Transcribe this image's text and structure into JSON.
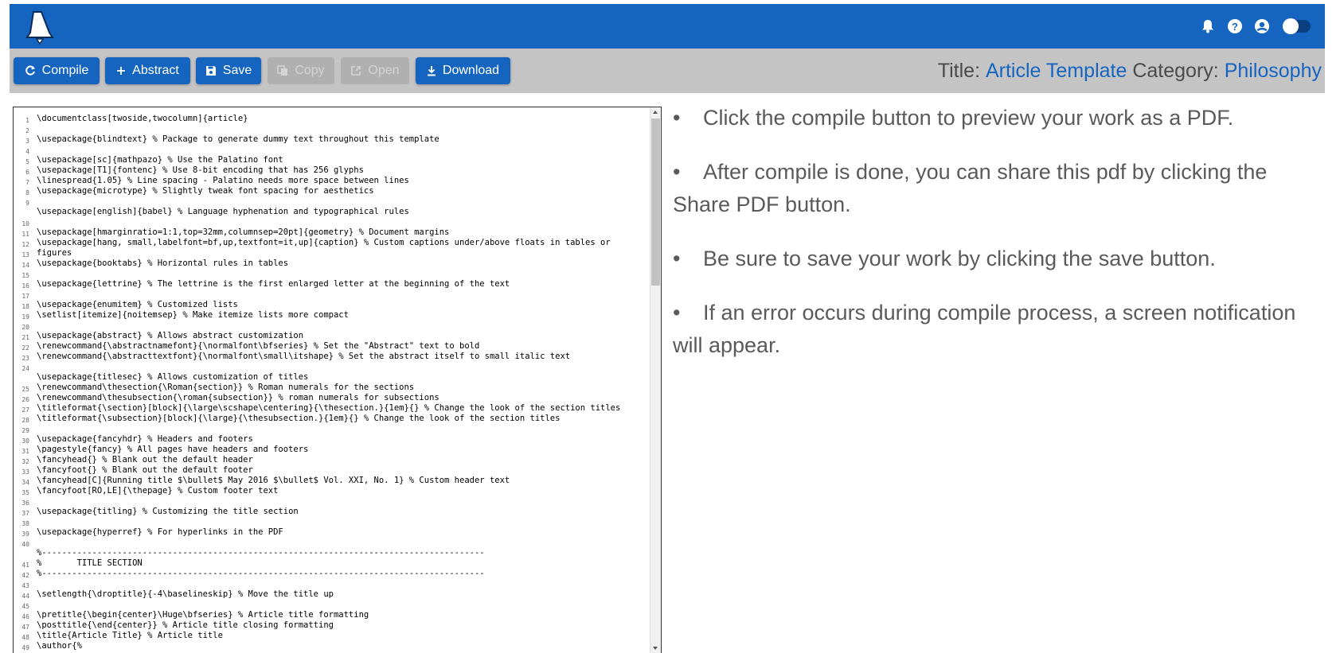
{
  "toolbar": {
    "compile_label": "Compile",
    "abstract_label": "Abstract",
    "save_label": "Save",
    "copy_label": "Copy",
    "open_label": "Open",
    "download_label": "Download"
  },
  "document": {
    "title_label": "Title:",
    "title_value": "Article Template",
    "category_label": "Category:",
    "category_value": "Philosophy"
  },
  "icons": {
    "logo": "bell-logo-icon",
    "notifications": "bell-icon",
    "help": "help-icon",
    "account": "account-icon",
    "theme_toggle": "toggle-icon"
  },
  "colors": {
    "primary": "#1565c0",
    "toolbar_bg": "#c4c4c4",
    "disabled": "#b0b0b0"
  },
  "editor": {
    "lines": [
      {
        "n": "1",
        "t": "\\documentclass[twoside,twocolumn]{article}"
      },
      {
        "n": "2",
        "t": ""
      },
      {
        "n": "3",
        "t": "\\usepackage{blindtext} % Package to generate dummy text throughout this template"
      },
      {
        "n": "4",
        "t": ""
      },
      {
        "n": "5",
        "t": "\\usepackage[sc]{mathpazo} % Use the Palatino font"
      },
      {
        "n": "6",
        "t": "\\usepackage[T1]{fontenc} % Use 8-bit encoding that has 256 glyphs"
      },
      {
        "n": "7",
        "t": "\\linespread{1.05} % Line spacing - Palatino needs more space between lines"
      },
      {
        "n": "8",
        "t": "\\usepackage{microtype} % Slightly tweak font spacing for aesthetics"
      },
      {
        "n": "9",
        "t": ""
      },
      {
        "n": "",
        "t": "\\usepackage[english]{babel} % Language hyphenation and typographical rules"
      },
      {
        "n": "10",
        "t": ""
      },
      {
        "n": "11",
        "t": "\\usepackage[hmarginratio=1:1,top=32mm,columnsep=20pt]{geometry} % Document margins"
      },
      {
        "n": "12",
        "t": "\\usepackage[hang, small,labelfont=bf,up,textfont=it,up]{caption} % Custom captions under/above floats in tables or"
      },
      {
        "n": "13",
        "t": "figures"
      },
      {
        "n": "14",
        "t": "\\usepackage{booktabs} % Horizontal rules in tables"
      },
      {
        "n": "15",
        "t": ""
      },
      {
        "n": "16",
        "t": "\\usepackage{lettrine} % The lettrine is the first enlarged letter at the beginning of the text"
      },
      {
        "n": "17",
        "t": ""
      },
      {
        "n": "18",
        "t": "\\usepackage{enumitem} % Customized lists"
      },
      {
        "n": "19",
        "t": "\\setlist[itemize]{noitemsep} % Make itemize lists more compact"
      },
      {
        "n": "20",
        "t": ""
      },
      {
        "n": "21",
        "t": "\\usepackage{abstract} % Allows abstract customization"
      },
      {
        "n": "22",
        "t": "\\renewcommand{\\abstractnamefont}{\\normalfont\\bfseries} % Set the \"Abstract\" text to bold"
      },
      {
        "n": "23",
        "t": "\\renewcommand{\\abstracttextfont}{\\normalfont\\small\\itshape} % Set the abstract itself to small italic text"
      },
      {
        "n": "24",
        "t": ""
      },
      {
        "n": "",
        "t": "\\usepackage{titlesec} % Allows customization of titles"
      },
      {
        "n": "25",
        "t": "\\renewcommand\\thesection{\\Roman{section}} % Roman numerals for the sections"
      },
      {
        "n": "26",
        "t": "\\renewcommand\\thesubsection{\\roman{subsection}} % roman numerals for subsections"
      },
      {
        "n": "27",
        "t": "\\titleformat{\\section}[block]{\\large\\scshape\\centering}{\\thesection.}{1em}{} % Change the look of the section titles"
      },
      {
        "n": "28",
        "t": "\\titleformat{\\subsection}[block]{\\large}{\\thesubsection.}{1em}{} % Change the look of the section titles"
      },
      {
        "n": "29",
        "t": ""
      },
      {
        "n": "30",
        "t": "\\usepackage{fancyhdr} % Headers and footers"
      },
      {
        "n": "31",
        "t": "\\pagestyle{fancy} % All pages have headers and footers"
      },
      {
        "n": "32",
        "t": "\\fancyhead{} % Blank out the default header"
      },
      {
        "n": "33",
        "t": "\\fancyfoot{} % Blank out the default footer"
      },
      {
        "n": "34",
        "t": "\\fancyhead[C]{Running title $\\bullet$ May 2016 $\\bullet$ Vol. XXI, No. 1} % Custom header text"
      },
      {
        "n": "35",
        "t": "\\fancyfoot[RO,LE]{\\thepage} % Custom footer text"
      },
      {
        "n": "36",
        "t": ""
      },
      {
        "n": "37",
        "t": "\\usepackage{titling} % Customizing the title section"
      },
      {
        "n": "38",
        "t": ""
      },
      {
        "n": "39",
        "t": "\\usepackage{hyperref} % For hyperlinks in the PDF"
      },
      {
        "n": "40",
        "t": ""
      },
      {
        "n": "",
        "t": "%----------------------------------------------------------------------------------------"
      },
      {
        "n": "41",
        "t": "%       TITLE SECTION"
      },
      {
        "n": "42",
        "t": "%----------------------------------------------------------------------------------------"
      },
      {
        "n": "43",
        "t": ""
      },
      {
        "n": "44",
        "t": "\\setlength{\\droptitle}{-4\\baselineskip} % Move the title up"
      },
      {
        "n": "45",
        "t": ""
      },
      {
        "n": "46",
        "t": "\\pretitle{\\begin{center}\\Huge\\bfseries} % Article title formatting"
      },
      {
        "n": "47",
        "t": "\\posttitle{\\end{center}} % Article title closing formatting"
      },
      {
        "n": "48",
        "t": "\\title{Article Title} % Article title"
      },
      {
        "n": "49",
        "t": "\\author{%"
      }
    ]
  },
  "help_items": [
    "Click the compile button to preview your work as a PDF.",
    "After compile is done, you can share this pdf by clicking the Share PDF button.",
    "Be sure to save your work by clicking the save button.",
    "If an error occurs during compile process, a screen notification will appear."
  ]
}
